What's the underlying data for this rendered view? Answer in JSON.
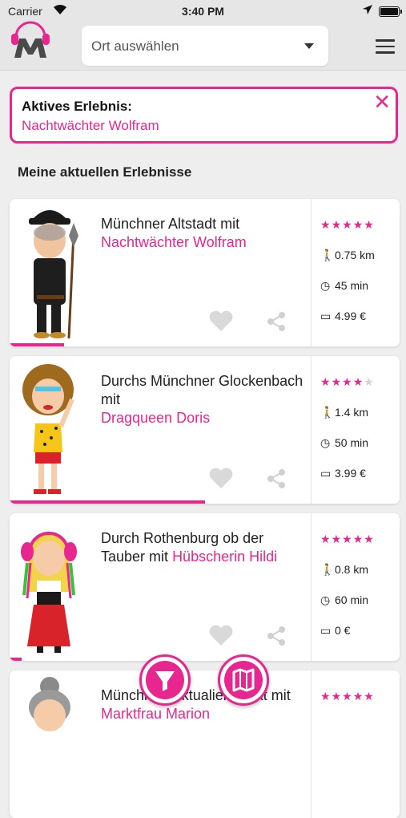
{
  "status_bar": {
    "carrier": "Carrier",
    "time": "3:40 PM"
  },
  "header": {
    "location_placeholder": "Ort auswählen"
  },
  "active_experience": {
    "label": "Aktives Erlebnis:",
    "name": "Nachtwächter Wolfram"
  },
  "section_title": "Meine aktuellen Erlebnisse",
  "colors": {
    "accent": "#e8268f",
    "header_bg": "#e6e6e6",
    "page_bg": "#eeeeee"
  },
  "tours": [
    {
      "title": "Münchner Altstadt mit",
      "guide": "Nachtwächter Wolfram",
      "rating": 5,
      "stars_total": 5,
      "distance": "0.75 km",
      "duration": "45 min",
      "price": "4.99 €",
      "progress": 0.14
    },
    {
      "title": "Durchs Münchner Glockenbach mit",
      "guide": "Dragqueen Doris",
      "rating": 4,
      "stars_total": 5,
      "distance": "1.4 km",
      "duration": "50 min",
      "price": "3.99 €",
      "progress": 0.5
    },
    {
      "title": "Durch Rothenburg ob der Tauber mit",
      "guide": "Hübscherin Hildi",
      "rating": 5,
      "stars_total": 5,
      "distance": "0.8 km",
      "duration": "60 min",
      "price": "0 €",
      "progress": 0.03
    },
    {
      "title": "Münchner Viktualienmarkt mit",
      "guide": "Marktfrau Marion",
      "rating": 5,
      "stars_total": 5
    }
  ],
  "icons": {
    "filter": "filter-icon",
    "map": "map-icon",
    "heart": "heart-icon",
    "share": "share-icon",
    "walk": "walk-icon",
    "clock": "clock-icon",
    "price": "card-icon"
  }
}
